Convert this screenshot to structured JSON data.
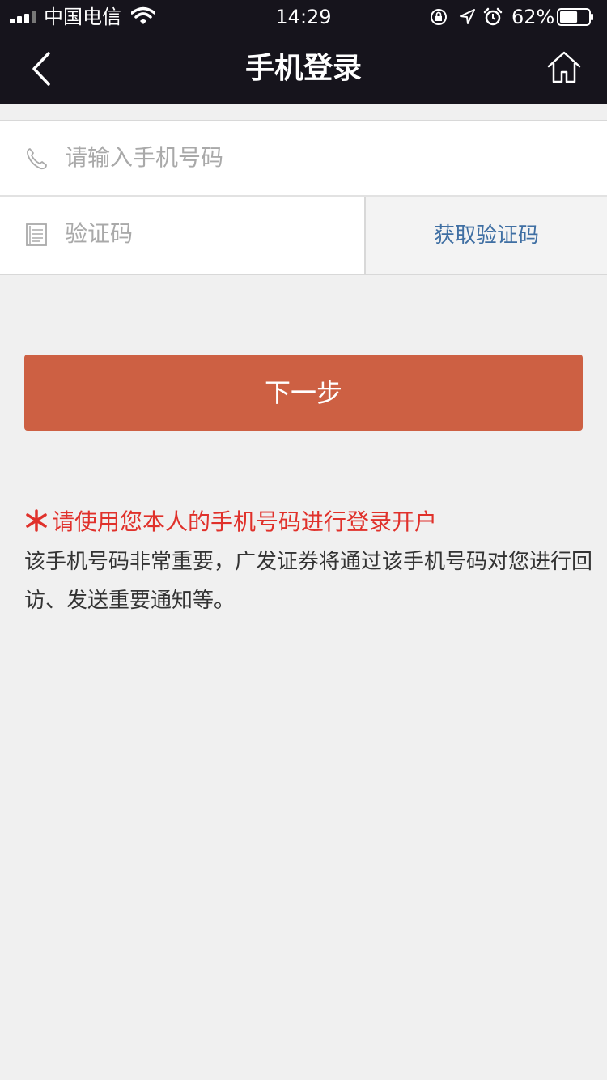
{
  "status_bar": {
    "carrier": "中国电信",
    "time": "14:29",
    "battery_percent": "62%",
    "battery_level": 0.62,
    "icons": [
      "signal-icon",
      "wifi-icon",
      "rotation-lock-icon",
      "location-icon",
      "alarm-icon",
      "battery-icon"
    ]
  },
  "nav": {
    "title": "手机登录",
    "back_icon": "chevron-left-icon",
    "home_icon": "home-icon"
  },
  "form": {
    "phone_placeholder": "请输入手机号码",
    "phone_value": "",
    "phone_icon": "phone-icon",
    "code_placeholder": "验证码",
    "code_value": "",
    "code_icon": "document-icon",
    "get_code_label": "获取验证码"
  },
  "next_button": {
    "label": "下一步"
  },
  "notice": {
    "title": "请使用您本人的手机号码进行登录开户",
    "body": "该手机号码非常重要，广发证券将通过该手机号码对您进行回访、发送重要通知等。"
  },
  "colors": {
    "header_bg": "#16141c",
    "primary_button": "#cd6043",
    "link_blue": "#3f6fa3",
    "notice_red": "#e0312b",
    "page_bg": "#f0f0f0"
  }
}
